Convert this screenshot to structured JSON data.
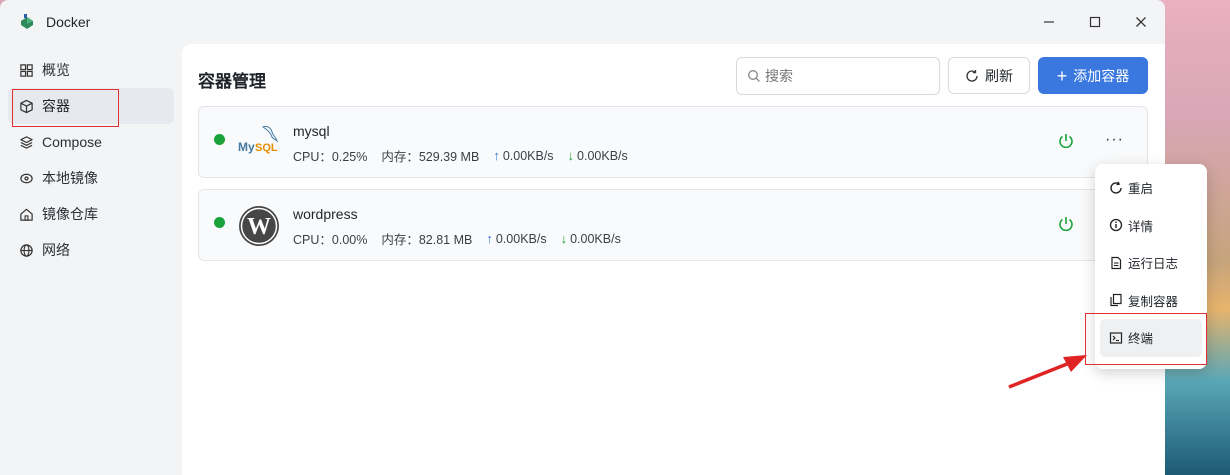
{
  "window": {
    "title": "Docker"
  },
  "sidebar": {
    "items": [
      {
        "label": "概览",
        "icon": "grid-icon"
      },
      {
        "label": "容器",
        "icon": "cube-icon",
        "active": true
      },
      {
        "label": "Compose",
        "icon": "layers-icon"
      },
      {
        "label": "本地镜像",
        "icon": "disk-icon"
      },
      {
        "label": "镜像仓库",
        "icon": "home-icon"
      },
      {
        "label": "网络",
        "icon": "globe-icon"
      }
    ]
  },
  "main": {
    "title": "容器管理",
    "search_placeholder": "搜索",
    "refresh_label": "刷新",
    "add_label": "添加容器"
  },
  "containers": [
    {
      "name": "mysql",
      "cpu": "CPU：0.25%",
      "mem": "内存：529.39 MB",
      "up": "0.00KB/s",
      "down": "0.00KB/s",
      "status": "running"
    },
    {
      "name": "wordpress",
      "cpu": "CPU：0.00%",
      "mem": "内存：82.81 MB",
      "up": "0.00KB/s",
      "down": "0.00KB/s",
      "status": "running"
    }
  ],
  "context_menu": {
    "items": [
      {
        "label": "重启",
        "icon": "restart-icon"
      },
      {
        "label": "详情",
        "icon": "info-icon"
      },
      {
        "label": "运行日志",
        "icon": "document-icon"
      },
      {
        "label": "复制容器",
        "icon": "copy-icon"
      },
      {
        "label": "终端",
        "icon": "terminal-icon"
      }
    ]
  },
  "colors": {
    "accent": "#3a78e0",
    "running": "#1aa33a",
    "highlight": "#e03030"
  }
}
